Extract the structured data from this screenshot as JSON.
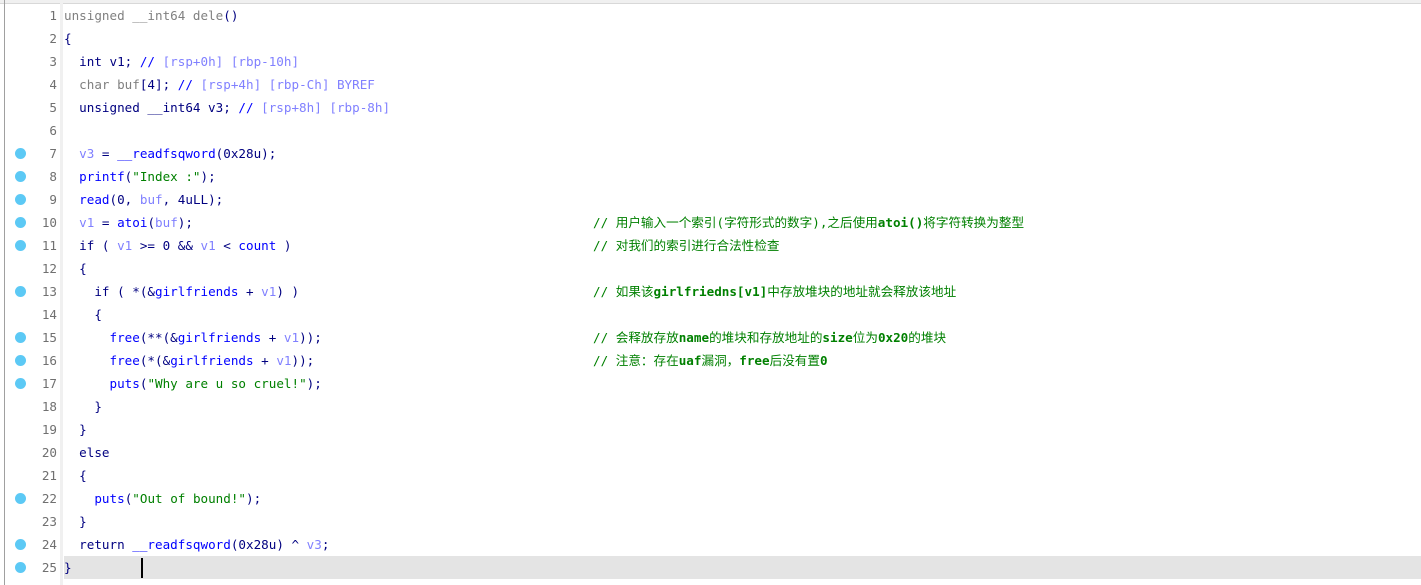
{
  "function_name": "dele",
  "breakpoint_color": "#5cc9f5",
  "current_line": 25,
  "lines": [
    {
      "n": "1",
      "dot": false,
      "tokens": [
        [
          "unsigned __int64 dele",
          "g"
        ],
        [
          "()",
          "n"
        ]
      ]
    },
    {
      "n": "2",
      "dot": false,
      "tokens": [
        [
          "{",
          "n"
        ]
      ]
    },
    {
      "n": "3",
      "dot": false,
      "tokens": [
        [
          "  int v1; ",
          "n"
        ],
        [
          "// ",
          "cb"
        ],
        [
          "[rsp+0h] [rbp-10h]",
          "c"
        ]
      ]
    },
    {
      "n": "4",
      "dot": false,
      "tokens": [
        [
          "  char buf",
          "g"
        ],
        [
          "[4]; ",
          "n"
        ],
        [
          "// ",
          "cb"
        ],
        [
          "[rsp+4h] [rbp-Ch] BYREF",
          "c"
        ]
      ]
    },
    {
      "n": "5",
      "dot": false,
      "tokens": [
        [
          "  unsigned __int64 v3; ",
          "n"
        ],
        [
          "// ",
          "cb"
        ],
        [
          "[rsp+8h] [rbp-8h]",
          "c"
        ]
      ]
    },
    {
      "n": "6",
      "dot": false,
      "tokens": []
    },
    {
      "n": "7",
      "dot": true,
      "tokens": [
        [
          "  ",
          "n"
        ],
        [
          "v3",
          "v"
        ],
        [
          " = ",
          "n"
        ],
        [
          "__readfsqword",
          "f"
        ],
        [
          "(0x28u);",
          "n"
        ]
      ]
    },
    {
      "n": "8",
      "dot": true,
      "tokens": [
        [
          "  ",
          "n"
        ],
        [
          "printf",
          "f"
        ],
        [
          "(",
          "n"
        ],
        [
          "\"Index :\"",
          "s"
        ],
        [
          ");",
          "n"
        ]
      ]
    },
    {
      "n": "9",
      "dot": true,
      "tokens": [
        [
          "  ",
          "n"
        ],
        [
          "read",
          "f"
        ],
        [
          "(0, ",
          "n"
        ],
        [
          "buf",
          "v"
        ],
        [
          ", 4uLL);",
          "n"
        ]
      ]
    },
    {
      "n": "10",
      "dot": true,
      "tokens": [
        [
          "  ",
          "n"
        ],
        [
          "v1",
          "v"
        ],
        [
          " = ",
          "n"
        ],
        [
          "atoi",
          "f"
        ],
        [
          "(",
          "n"
        ],
        [
          "buf",
          "v"
        ],
        [
          ");",
          "n"
        ]
      ],
      "comment": [
        [
          "// 用户输入一个索引(字符形式的数字),之后使用",
          ""
        ],
        [
          "atoi()",
          "b"
        ],
        [
          "将字符转换为整型",
          ""
        ]
      ]
    },
    {
      "n": "11",
      "dot": true,
      "tokens": [
        [
          "  if ( ",
          "n"
        ],
        [
          "v1",
          "v"
        ],
        [
          " >= 0 && ",
          "n"
        ],
        [
          "v1",
          "v"
        ],
        [
          " < ",
          "n"
        ],
        [
          "count",
          "f"
        ],
        [
          " )",
          "n"
        ]
      ],
      "comment": [
        [
          "// 对我们的索引进行合法性检查",
          ""
        ]
      ]
    },
    {
      "n": "12",
      "dot": false,
      "tokens": [
        [
          "  {",
          "n"
        ]
      ]
    },
    {
      "n": "13",
      "dot": true,
      "tokens": [
        [
          "    if ( *(&",
          "n"
        ],
        [
          "girlfriends",
          "f"
        ],
        [
          " + ",
          "n"
        ],
        [
          "v1",
          "v"
        ],
        [
          ") )",
          "n"
        ]
      ],
      "comment": [
        [
          "// 如果该",
          ""
        ],
        [
          "girlfriedns[v1]",
          "b"
        ],
        [
          "中存放堆块的地址就会释放该地址",
          ""
        ]
      ]
    },
    {
      "n": "14",
      "dot": false,
      "tokens": [
        [
          "    {",
          "n"
        ]
      ]
    },
    {
      "n": "15",
      "dot": true,
      "tokens": [
        [
          "      ",
          "n"
        ],
        [
          "free",
          "f"
        ],
        [
          "(**(&",
          "n"
        ],
        [
          "girlfriends",
          "f"
        ],
        [
          " + ",
          "n"
        ],
        [
          "v1",
          "v"
        ],
        [
          "));",
          "n"
        ]
      ],
      "comment": [
        [
          "// 会释放存放",
          ""
        ],
        [
          "name",
          "b"
        ],
        [
          "的堆块和存放地址的",
          ""
        ],
        [
          "size",
          "b"
        ],
        [
          "位为",
          ""
        ],
        [
          "0x20",
          "b"
        ],
        [
          "的堆块",
          ""
        ]
      ]
    },
    {
      "n": "16",
      "dot": true,
      "tokens": [
        [
          "      ",
          "n"
        ],
        [
          "free",
          "f"
        ],
        [
          "(*(&",
          "n"
        ],
        [
          "girlfriends",
          "f"
        ],
        [
          " + ",
          "n"
        ],
        [
          "v1",
          "v"
        ],
        [
          "));",
          "n"
        ]
      ],
      "comment": [
        [
          "// 注意：存在",
          ""
        ],
        [
          "uaf",
          "b"
        ],
        [
          "漏洞，",
          ""
        ],
        [
          "free",
          "b"
        ],
        [
          "后没有置",
          ""
        ],
        [
          "0",
          "b"
        ]
      ]
    },
    {
      "n": "17",
      "dot": true,
      "tokens": [
        [
          "      ",
          "n"
        ],
        [
          "puts",
          "f"
        ],
        [
          "(",
          "n"
        ],
        [
          "\"Why are u so cruel!\"",
          "s"
        ],
        [
          ");",
          "n"
        ]
      ]
    },
    {
      "n": "18",
      "dot": false,
      "tokens": [
        [
          "    }",
          "n"
        ]
      ]
    },
    {
      "n": "19",
      "dot": false,
      "tokens": [
        [
          "  }",
          "n"
        ]
      ]
    },
    {
      "n": "20",
      "dot": false,
      "tokens": [
        [
          "  else",
          "n"
        ]
      ]
    },
    {
      "n": "21",
      "dot": false,
      "tokens": [
        [
          "  {",
          "n"
        ]
      ]
    },
    {
      "n": "22",
      "dot": true,
      "tokens": [
        [
          "    ",
          "n"
        ],
        [
          "puts",
          "f"
        ],
        [
          "(",
          "n"
        ],
        [
          "\"Out of bound!\"",
          "s"
        ],
        [
          ");",
          "n"
        ]
      ]
    },
    {
      "n": "23",
      "dot": false,
      "tokens": [
        [
          "  }",
          "n"
        ]
      ]
    },
    {
      "n": "24",
      "dot": true,
      "tokens": [
        [
          "  return ",
          "n"
        ],
        [
          "__readfsqword",
          "f"
        ],
        [
          "(0x28u) ^ ",
          "n"
        ],
        [
          "v3",
          "v"
        ],
        [
          ";",
          "n"
        ]
      ]
    },
    {
      "n": "25",
      "dot": true,
      "tokens": [
        [
          "}",
          "n"
        ]
      ]
    }
  ]
}
